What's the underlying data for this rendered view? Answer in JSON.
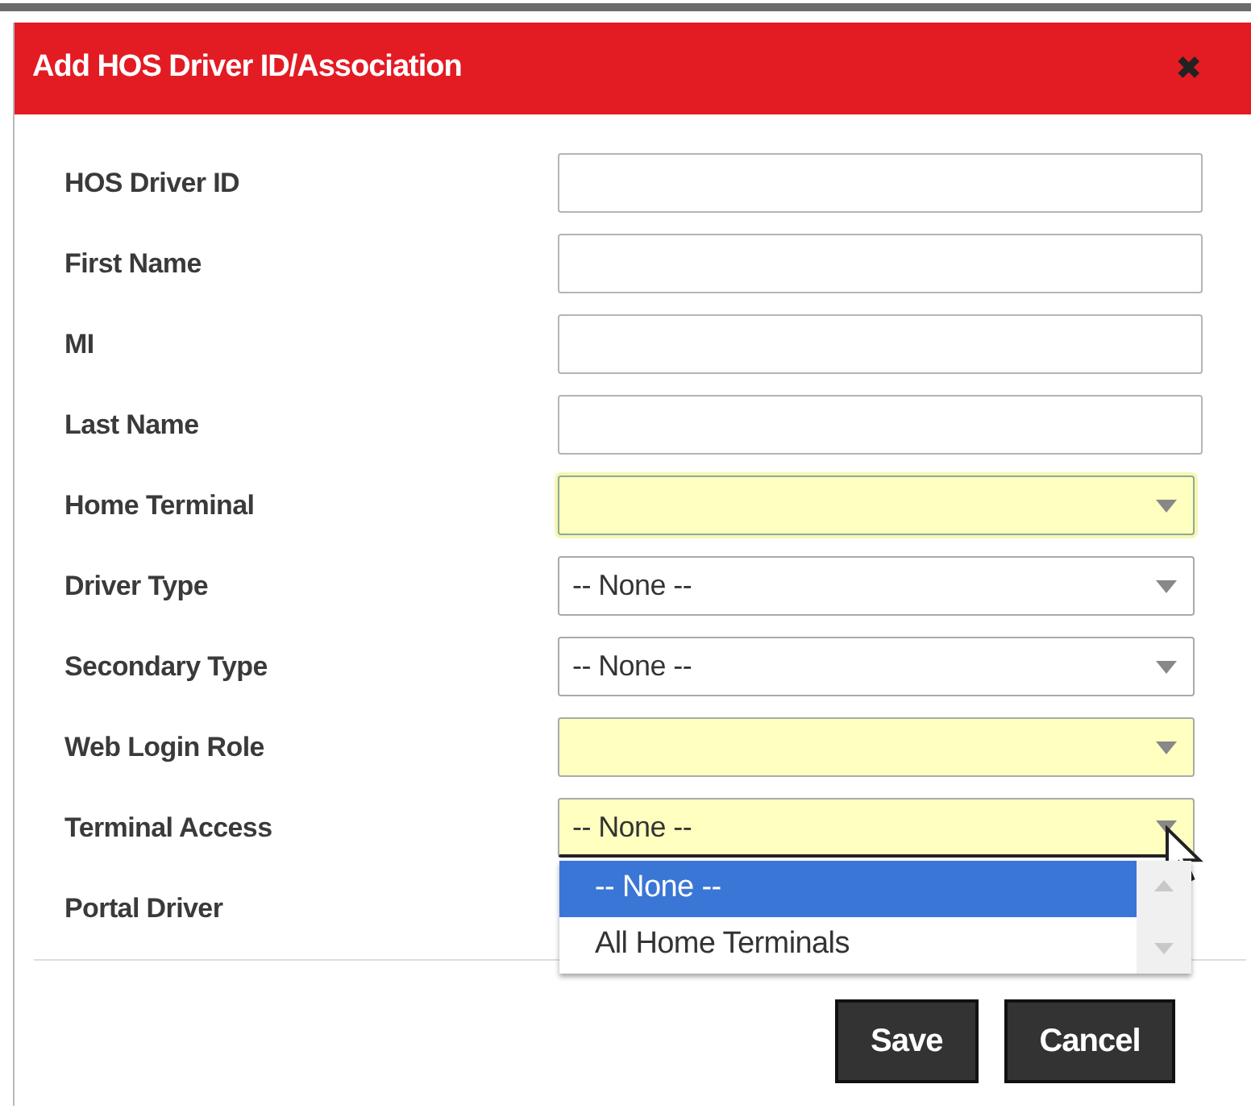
{
  "dialog": {
    "title": "Add HOS Driver ID/Association",
    "close": "✖"
  },
  "fields": [
    {
      "label": "HOS Driver ID",
      "kind": "text",
      "required": false,
      "focused": false
    },
    {
      "label": "First Name",
      "kind": "text",
      "required": false,
      "focused": false
    },
    {
      "label": "MI",
      "kind": "text",
      "required": false,
      "focused": false
    },
    {
      "label": "Last Name",
      "kind": "text",
      "required": false,
      "focused": false
    },
    {
      "label": "Home Terminal",
      "kind": "select",
      "required": true,
      "focused": true
    },
    {
      "label": "Driver Type",
      "kind": "select",
      "value": "-- None --",
      "required": false,
      "focused": false
    },
    {
      "label": "Secondary Type",
      "kind": "select",
      "value": "-- None --",
      "required": false,
      "focused": false
    },
    {
      "label": "Web Login Role",
      "kind": "select",
      "required": true,
      "focused": false
    },
    {
      "label": "Terminal Access",
      "kind": "select",
      "value": "-- None --",
      "required": true,
      "focused": false,
      "expanded": true,
      "options": [
        {
          "label": "-- None --",
          "selected": true
        },
        {
          "label": "All Home Terminals",
          "selected": false
        }
      ]
    },
    {
      "label": "Portal Driver",
      "kind": "covered"
    }
  ],
  "buttons": [
    "Save",
    "Cancel"
  ]
}
